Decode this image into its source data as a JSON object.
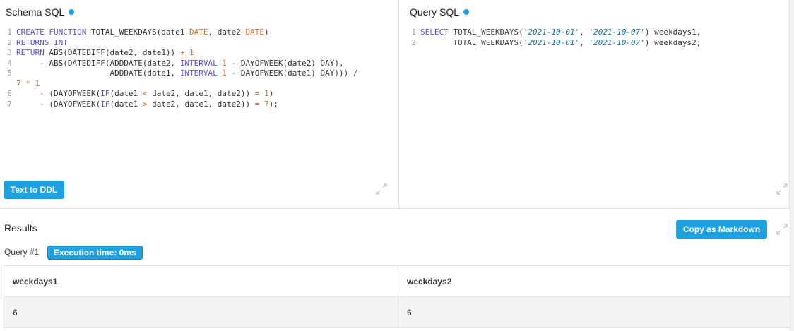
{
  "colors": {
    "accent": "#1ea1e1",
    "keyword": "#5a52c4",
    "string": "#1a6fa8",
    "number": "#d07030"
  },
  "schema": {
    "title": "Schema SQL",
    "lines": [
      [
        {
          "t": "CREATE FUNCTION",
          "c": "kw"
        },
        {
          "t": " TOTAL_WEEKDAYS(date1 ",
          "c": "txt"
        },
        {
          "t": "DATE",
          "c": "num"
        },
        {
          "t": ", date2 ",
          "c": "txt"
        },
        {
          "t": "DATE",
          "c": "num"
        },
        {
          "t": ")",
          "c": "txt"
        }
      ],
      [
        {
          "t": "RETURNS INT",
          "c": "kw"
        }
      ],
      [
        {
          "t": "RETURN",
          "c": "kw"
        },
        {
          "t": " ABS(DATEDIFF(date2, date1)) ",
          "c": "txt"
        },
        {
          "t": "+ 1",
          "c": "num"
        }
      ],
      [
        {
          "t": "     ",
          "c": "txt"
        },
        {
          "t": "-",
          "c": "op"
        },
        {
          "t": " ABS(DATEDIFF(ADDDATE(date2, ",
          "c": "txt"
        },
        {
          "t": "INTERVAL",
          "c": "kw"
        },
        {
          "t": " ",
          "c": "txt"
        },
        {
          "t": "1",
          "c": "num"
        },
        {
          "t": " ",
          "c": "txt"
        },
        {
          "t": "-",
          "c": "op"
        },
        {
          "t": " DAYOFWEEK(date2) DAY),",
          "c": "txt"
        }
      ],
      [
        {
          "t": "                    ADDDATE(date1, ",
          "c": "txt"
        },
        {
          "t": "INTERVAL",
          "c": "kw"
        },
        {
          "t": " ",
          "c": "txt"
        },
        {
          "t": "1",
          "c": "num"
        },
        {
          "t": " ",
          "c": "txt"
        },
        {
          "t": "-",
          "c": "op"
        },
        {
          "t": " DAYOFWEEK(date1) DAY))) /",
          "c": "txt"
        }
      ],
      [
        {
          "t": "7 * 1",
          "c": "num"
        }
      ],
      [
        {
          "t": "     ",
          "c": "txt"
        },
        {
          "t": "-",
          "c": "op"
        },
        {
          "t": " (DAYOFWEEK(",
          "c": "txt"
        },
        {
          "t": "IF",
          "c": "kw"
        },
        {
          "t": "(date1 ",
          "c": "txt"
        },
        {
          "t": "<",
          "c": "op"
        },
        {
          "t": " date2, date1, date2)) ",
          "c": "txt"
        },
        {
          "t": "= 1",
          "c": "num"
        },
        {
          "t": ")",
          "c": "txt"
        }
      ],
      [
        {
          "t": "     ",
          "c": "txt"
        },
        {
          "t": "-",
          "c": "op"
        },
        {
          "t": " (DAYOFWEEK(",
          "c": "txt"
        },
        {
          "t": "IF",
          "c": "kw"
        },
        {
          "t": "(date1 ",
          "c": "txt"
        },
        {
          "t": ">",
          "c": "op"
        },
        {
          "t": " date2, date1, date2)) ",
          "c": "txt"
        },
        {
          "t": "= 7",
          "c": "num"
        },
        {
          "t": ");",
          "c": "txt"
        }
      ]
    ],
    "line_numbers": [
      "1",
      "2",
      "3",
      "4",
      "5",
      "",
      "6",
      "7"
    ],
    "button_label": "Text to DDL",
    "expand_icon": "expand-icon"
  },
  "query": {
    "title": "Query SQL",
    "lines": [
      [
        {
          "t": "SELECT",
          "c": "kw"
        },
        {
          "t": " TOTAL_WEEKDAYS(",
          "c": "txt"
        },
        {
          "t": "'2021-10-01'",
          "c": "str"
        },
        {
          "t": ", ",
          "c": "txt"
        },
        {
          "t": "'2021-10-07'",
          "c": "str"
        },
        {
          "t": ") weekdays1,",
          "c": "txt"
        }
      ],
      [
        {
          "t": "       TOTAL_WEEKDAYS(",
          "c": "txt"
        },
        {
          "t": "'2021-10-01'",
          "c": "str"
        },
        {
          "t": ", ",
          "c": "txt"
        },
        {
          "t": "'2021-10-07'",
          "c": "str"
        },
        {
          "t": ") weekdays2;",
          "c": "txt"
        }
      ]
    ],
    "line_numbers": [
      "1",
      "2"
    ],
    "expand_icon": "expand-icon"
  },
  "results": {
    "title": "Results",
    "copy_button_label": "Copy as Markdown",
    "query_label": "Query #1",
    "execution_badge": "Execution time: 0ms",
    "columns": [
      "weekdays1",
      "weekdays2"
    ],
    "rows": [
      [
        "6",
        "6"
      ]
    ]
  }
}
